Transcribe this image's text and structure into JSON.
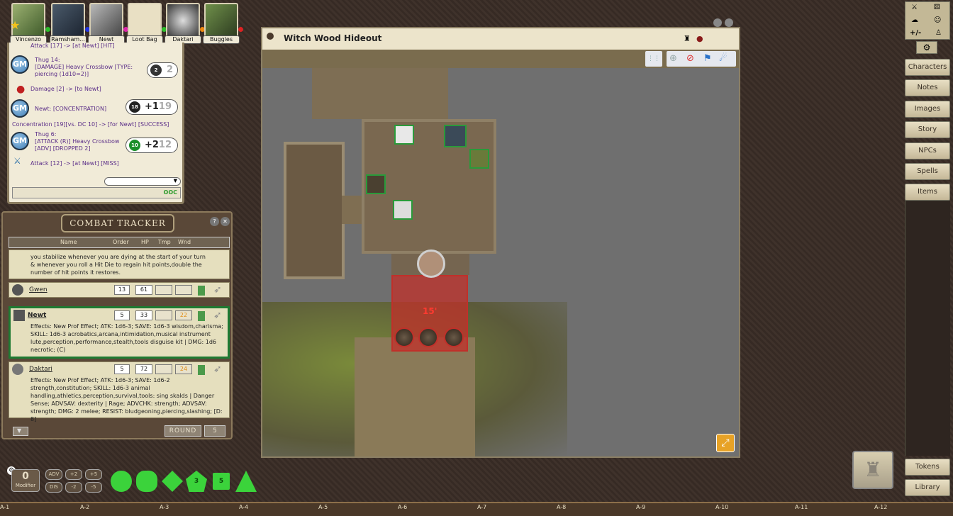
{
  "party": [
    {
      "name": "Vincenzo",
      "dot": "#2bbd2b",
      "star": true
    },
    {
      "name": "Ramsham...",
      "dot": "#2233dd"
    },
    {
      "name": "Newt",
      "dot": "#dd22aa"
    },
    {
      "name": "Loot Bag",
      "dot": "#2bbd2b"
    },
    {
      "name": "Daktari",
      "dot": "#ee8811"
    },
    {
      "name": "Buggles",
      "dot": "#dd2222"
    }
  ],
  "chat": {
    "line1": "Attack [17] -> [at Newt] [HIT]",
    "thug14_name": "Thug 14:",
    "thug14_text": "[DAMAGE] Heavy Crossbow [TYPE: piercing (1d10=2)]",
    "thug14_die": "2",
    "thug14_total": "2",
    "damage_line": "Damage [2] -> [to Newt]",
    "newt_conc": "Newt: [CONCENTRATION]",
    "newt_die": "18",
    "newt_mod": "+1",
    "newt_total": "19",
    "conc_result": "Concentration [19][vs. DC 10] -> [for Newt] [SUCCESS]",
    "thug6_name": "Thug 6:",
    "thug6_text": "[ATTACK (R)] Heavy Crossbow [ADV] [DROPPED 2]",
    "thug6_die": "10",
    "thug6_mod": "+2",
    "thug6_total": "12",
    "attack_line": "Attack [12] -> [at Newt] [MISS]",
    "gm_label": "GM",
    "ooc": "OOC"
  },
  "combat_tracker": {
    "title": "COMBAT TRACKER",
    "columns": [
      "Name",
      "Order",
      "HP",
      "Tmp",
      "Wnd"
    ],
    "top_text": "you stabilize whenever you are dying at the start of your turn & whenever you roll a Hit Die to regain hit points,double the number of hit points it restores.",
    "entries": [
      {
        "name": "Gwen",
        "order": "13",
        "hp": "61",
        "tmp": "",
        "wnd": ""
      },
      {
        "name": "Newt",
        "order": "5",
        "hp": "33",
        "tmp": "",
        "wnd": "22",
        "effects": "Effects: New Prof Effect; ATK: 1d6-3; SAVE: 1d6-3 wisdom,charisma; SKILL: 1d6-3 acrobatics,arcana,intimidation,musical instrument lute,perception,performance,stealth,tools disguise kit | DMG: 1d6 necrotic; (C)"
      },
      {
        "name": "Daktari",
        "order": "5",
        "hp": "72",
        "tmp": "",
        "wnd": "24",
        "effects": "Effects: New Prof Effect; ATK: 1d6-3; SAVE: 1d6-2 strength,constitution; SKILL: 1d6-3 animal handling,athletics,perception,survival,tools: sing skalds | Danger Sense; ADVSAV: dexterity | Rage; ADVCHK: strength; ADVSAV: strength; DMG: 2 melee; RESIST: bludgeoning,piercing,slashing; [D: 8]"
      }
    ],
    "round_label": "ROUND",
    "round_value": "5"
  },
  "map": {
    "title": "Witch Wood Hideout",
    "range_label": "15'"
  },
  "sidebar": [
    "Characters",
    "Notes",
    "Images",
    "Story",
    "NPCs",
    "Spells",
    "Items"
  ],
  "sidebar_bottom": [
    "Tokens",
    "Library"
  ],
  "toolbar": {
    "plus_minus": "+/-"
  },
  "modifier": {
    "value": "0",
    "label": "Modifier"
  },
  "mod_buttons": [
    "ADV",
    "+2",
    "+5",
    "DIS",
    "-2",
    "-5"
  ],
  "dice": [
    "d4",
    "d6",
    "d8",
    "d10",
    "d12",
    "d20"
  ],
  "dice_labels": [
    "",
    "",
    "",
    "3",
    "5",
    ""
  ],
  "coords": [
    "A-1",
    "A-2",
    "A-3",
    "A-4",
    "A-5",
    "A-6",
    "A-7",
    "A-8",
    "A-9",
    "A-10",
    "A-11",
    "A-12"
  ],
  "colors": {
    "accent_green": "#2bbd2b",
    "range_red": "#c0302a",
    "parchment": "#e5dfbe"
  }
}
